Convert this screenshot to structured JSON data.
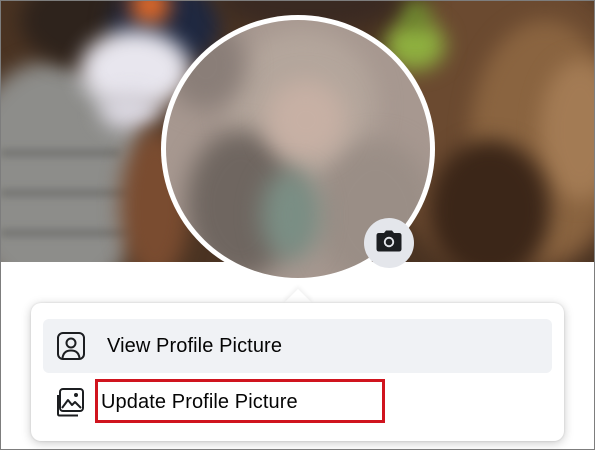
{
  "profile_menu": {
    "items": [
      {
        "label": "View Profile Picture",
        "icon": "person-portrait-icon"
      },
      {
        "label": "Update Profile Picture",
        "icon": "image-edit-icon"
      }
    ]
  },
  "camera_button": {
    "icon": "camera-icon"
  },
  "colors": {
    "menu_background": "#ffffff",
    "hover_background": "#f0f2f5",
    "camera_button_background": "#e4e6eb",
    "highlight_border": "#d0141e",
    "text": "#050505"
  }
}
